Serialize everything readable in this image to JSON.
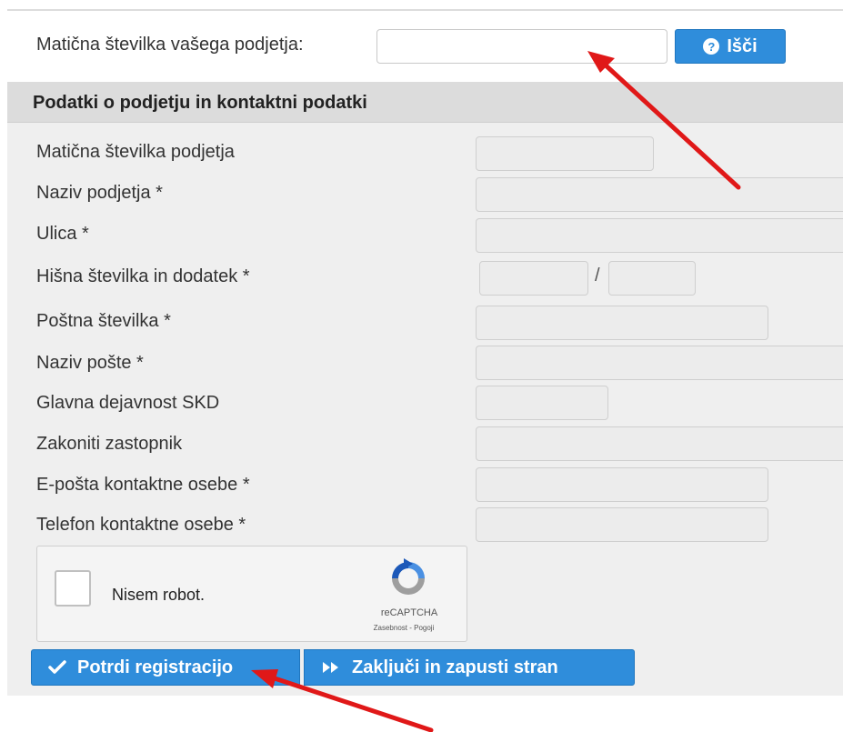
{
  "search": {
    "label": "Matična številka vašega podjetja:",
    "value": "",
    "placeholder": "",
    "button_label": "Išči",
    "button_icon": "question-circle-icon"
  },
  "panel": {
    "title": "Podatki o podjetju in kontaktni podatki"
  },
  "fields": {
    "maticna": {
      "label": "Matična številka podjetja",
      "value": ""
    },
    "naziv": {
      "label": "Naziv podjetja *",
      "value": ""
    },
    "ulica": {
      "label": "Ulica *",
      "value": ""
    },
    "hisna": {
      "label": "Hišna številka in dodatek *",
      "value": "",
      "dodatek_value": "",
      "separator": "/"
    },
    "postna": {
      "label": "Poštna številka *",
      "value": ""
    },
    "posta": {
      "label": "Naziv pošte *",
      "value": ""
    },
    "skd": {
      "label": "Glavna dejavnost SKD",
      "value": ""
    },
    "zastopnik": {
      "label": "Zakoniti zastopnik",
      "value": ""
    },
    "email": {
      "label": "E-pošta kontaktne osebe *",
      "value": ""
    },
    "telefon": {
      "label": "Telefon kontaktne osebe *",
      "value": ""
    }
  },
  "captcha": {
    "label": "Nisem robot.",
    "brand": "reCAPTCHA",
    "links": "Zasebnost - Pogoji",
    "checked": false
  },
  "actions": {
    "confirm_label": "Potrdi registracijo",
    "confirm_icon": "checkmark-icon",
    "exit_label": "Zaključi in zapusti stran",
    "exit_icon": "fast-forward-icon"
  },
  "colors": {
    "primary": "#2f8ddb",
    "panel_bg": "#efefef",
    "header_bg": "#dcdcdc",
    "arrow": "#e01818"
  }
}
